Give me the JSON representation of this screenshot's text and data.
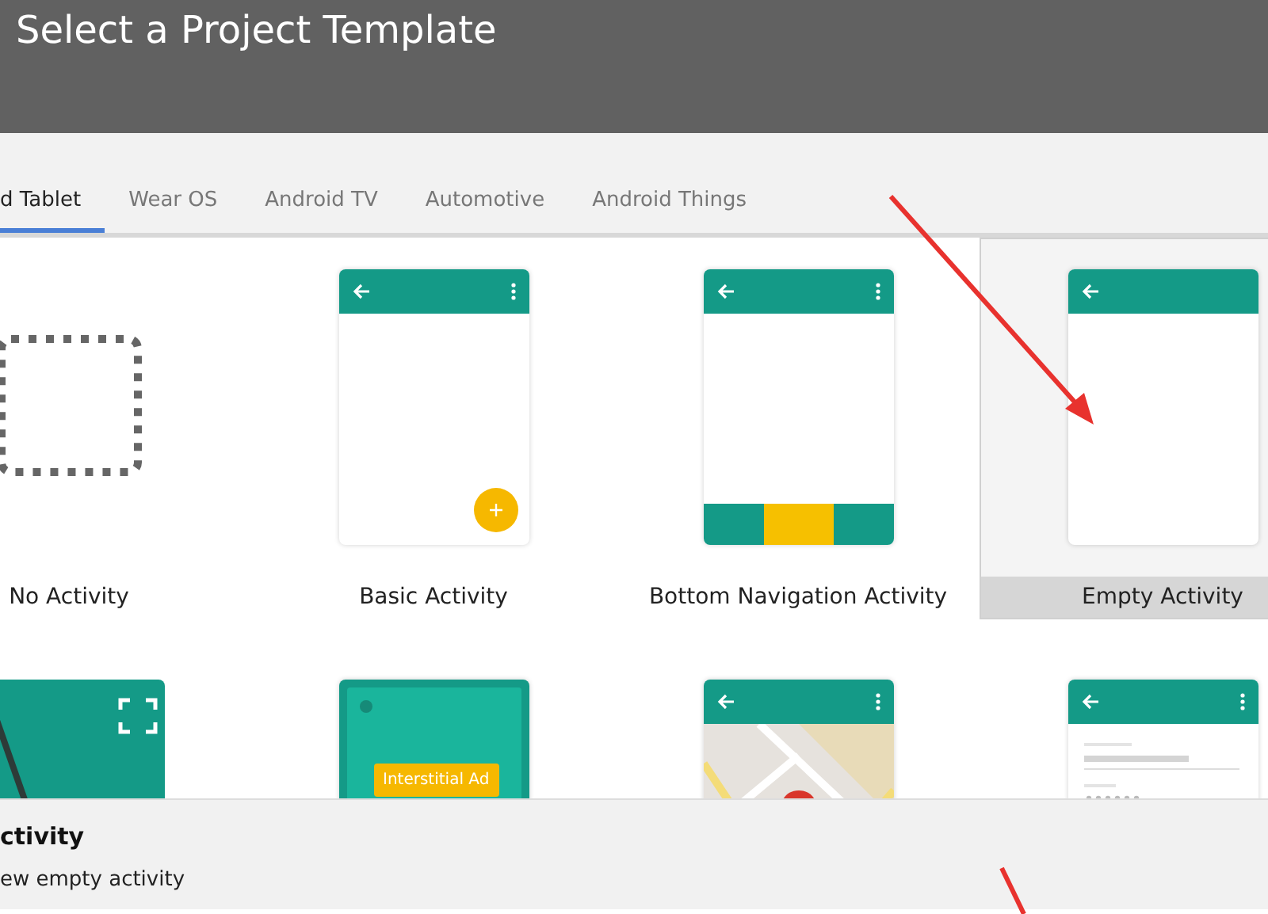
{
  "header": {
    "title": "Select a Project Template"
  },
  "tabs": [
    {
      "label": "d Tablet",
      "selected": true
    },
    {
      "label": "Wear OS",
      "selected": false
    },
    {
      "label": "Android TV",
      "selected": false
    },
    {
      "label": "Automotive",
      "selected": false
    },
    {
      "label": "Android Things",
      "selected": false
    }
  ],
  "templates": [
    {
      "kind": "no_activity",
      "label": "No Activity",
      "selected": false
    },
    {
      "kind": "basic",
      "label": "Basic Activity",
      "selected": false
    },
    {
      "kind": "bottom_navigation",
      "label": "Bottom Navigation Activity",
      "selected": false
    },
    {
      "kind": "empty",
      "label": "Empty Activity",
      "selected": true
    },
    {
      "kind": "fullscreen",
      "selected": false
    },
    {
      "kind": "interstitial",
      "ad_label": "Interstitial Ad",
      "selected": false
    },
    {
      "kind": "maps",
      "selected": false
    },
    {
      "kind": "login",
      "selected": false
    }
  ],
  "details": {
    "title": "ctivity",
    "description": "ew empty activity"
  }
}
